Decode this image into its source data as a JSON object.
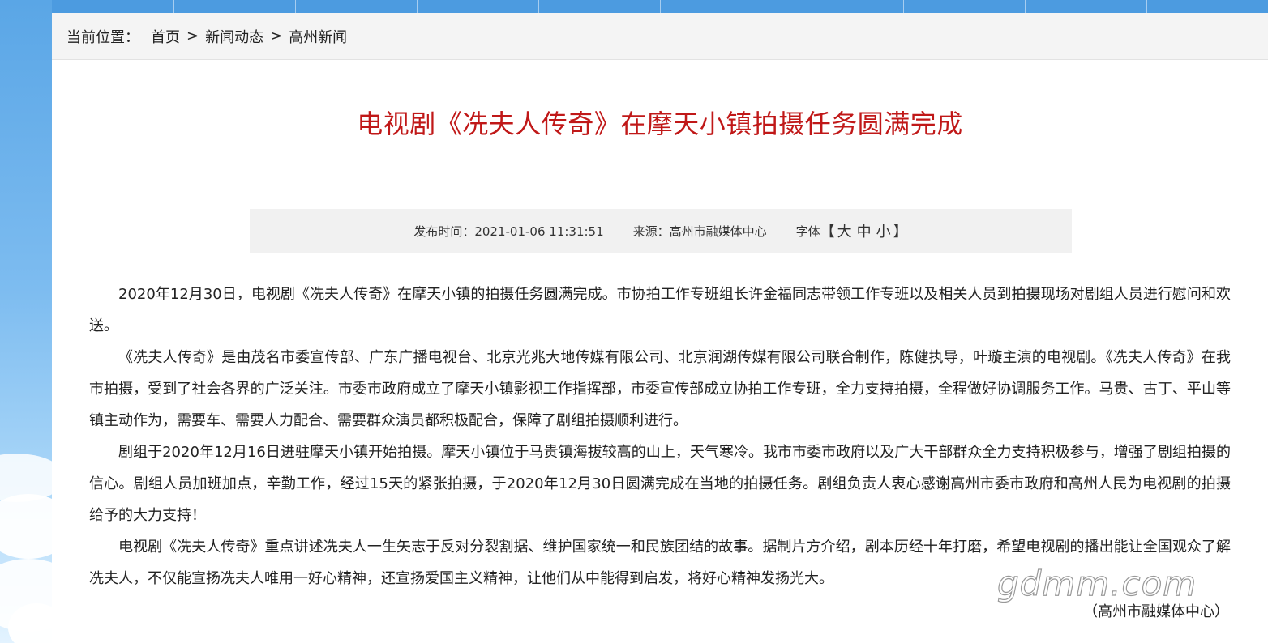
{
  "breadcrumb": {
    "prefix": "当前位置：",
    "items": [
      "首页",
      "新闻动态",
      "高州新闻"
    ],
    "separator": ">"
  },
  "article": {
    "title": "电视剧《冼夫人传奇》在摩天小镇拍摄任务圆满完成",
    "meta": {
      "publish_time": "发布时间：2021-01-06 11:31:51",
      "source": "来源：高州市融媒体中心",
      "font_label": "字体",
      "bracket_open": "【",
      "bracket_close": "】",
      "font_options": [
        "大",
        "中",
        "小"
      ]
    },
    "paragraphs": [
      "2020年12月30日，电视剧《冼夫人传奇》在摩天小镇的拍摄任务圆满完成。市协拍工作专班组长许金福同志带领工作专班以及相关人员到拍摄现场对剧组人员进行慰问和欢送。",
      "《冼夫人传奇》是由茂名市委宣传部、广东广播电视台、北京光兆大地传媒有限公司、北京润湖传媒有限公司联合制作，陈健执导，叶璇主演的电视剧。《冼夫人传奇》在我市拍摄，受到了社会各界的广泛关注。市委市政府成立了摩天小镇影视工作指挥部，市委宣传部成立协拍工作专班，全力支持拍摄，全程做好协调服务工作。马贵、古丁、平山等镇主动作为，需要车、需要人力配合、需要群众演员都积极配合，保障了剧组拍摄顺利进行。",
      "剧组于2020年12月16日进驻摩天小镇开始拍摄。摩天小镇位于马贵镇海拔较高的山上，天气寒冷。我市市委市政府以及广大干部群众全力支持积极参与，增强了剧组拍摄的信心。剧组人员加班加点，辛勤工作，经过15天的紧张拍摄，于2020年12月30日圆满完成在当地的拍摄任务。剧组负责人衷心感谢高州市委市政府和高州人民为电视剧的拍摄给予的大力支持！",
      "电视剧《冼夫人传奇》重点讲述冼夫人一生矢志于反对分裂割据、维护国家统一和民族团结的故事。据制片方介绍，剧本历经十年打磨，希望电视剧的播出能让全国观众了解冼夫人，不仅能宣扬冼夫人唯用一好心精神，还宣扬爱国主义精神，让他们从中能得到启发，将好心精神发扬光大。"
    ],
    "source_line": "（高州市融媒体中心）"
  },
  "watermark": "gdmm.com",
  "colors": {
    "title": "#c01818",
    "meta_bg": "#f1f1f1",
    "breadcrumb_bg": "#f4f4f4"
  }
}
